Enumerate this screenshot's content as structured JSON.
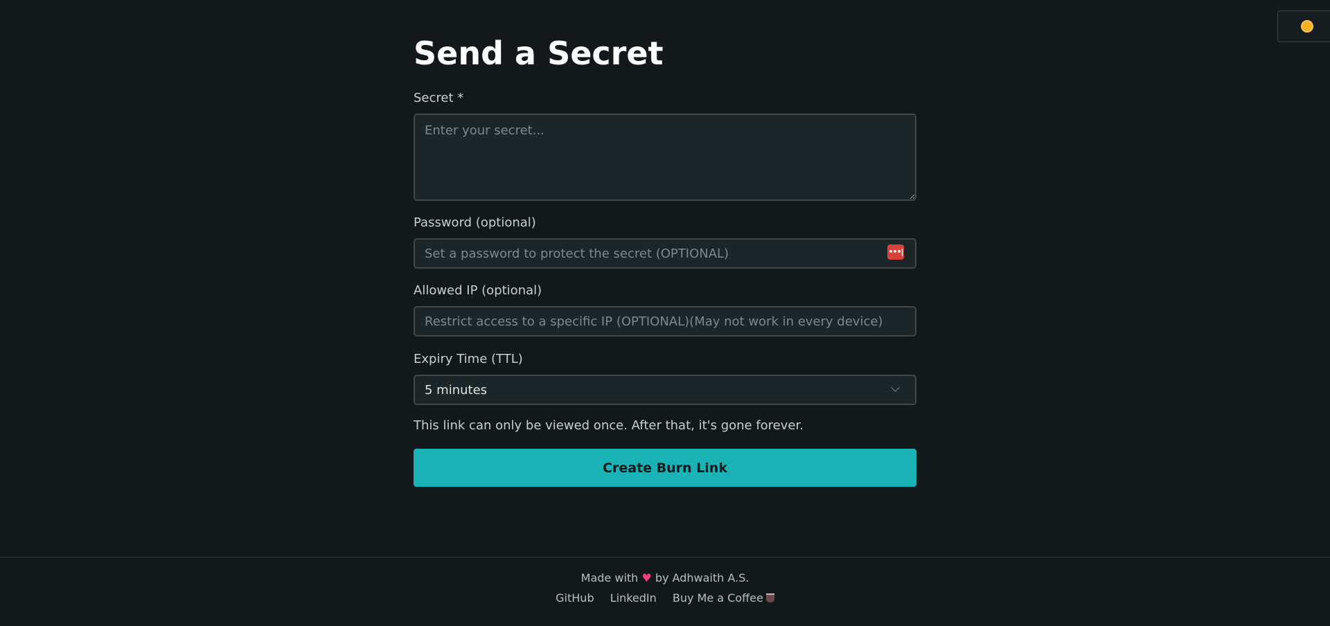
{
  "form": {
    "title": "Send a Secret",
    "secret": {
      "label": "Secret *",
      "placeholder": "Enter your secret...",
      "value": ""
    },
    "password": {
      "label": "Password (optional)",
      "placeholder": "Set a password to protect the secret (OPTIONAL)",
      "value": "",
      "manager_icon_glyph": "•••|"
    },
    "allowed_ip": {
      "label": "Allowed IP (optional)",
      "placeholder": "Restrict access to a specific IP (OPTIONAL)(May not work in every device)",
      "value": ""
    },
    "expiry": {
      "label": "Expiry Time (TTL)",
      "selected": "5 minutes"
    },
    "note": "This link can only be viewed once. After that, it's gone forever.",
    "submit_label": "Create Burn Link"
  },
  "theme_toggle": {
    "icon": "sun-icon"
  },
  "footer": {
    "credit_prefix": "Made with",
    "credit_heart": "♥",
    "credit_suffix": "by Adhwaith A.S.",
    "links": [
      {
        "label": "GitHub"
      },
      {
        "label": "LinkedIn"
      },
      {
        "label": "Buy Me a Coffee"
      }
    ]
  },
  "colors": {
    "background": "#13181a",
    "accent": "#1ab2b4",
    "input_background": "#1c2527",
    "input_border": "#3c4a4d"
  }
}
